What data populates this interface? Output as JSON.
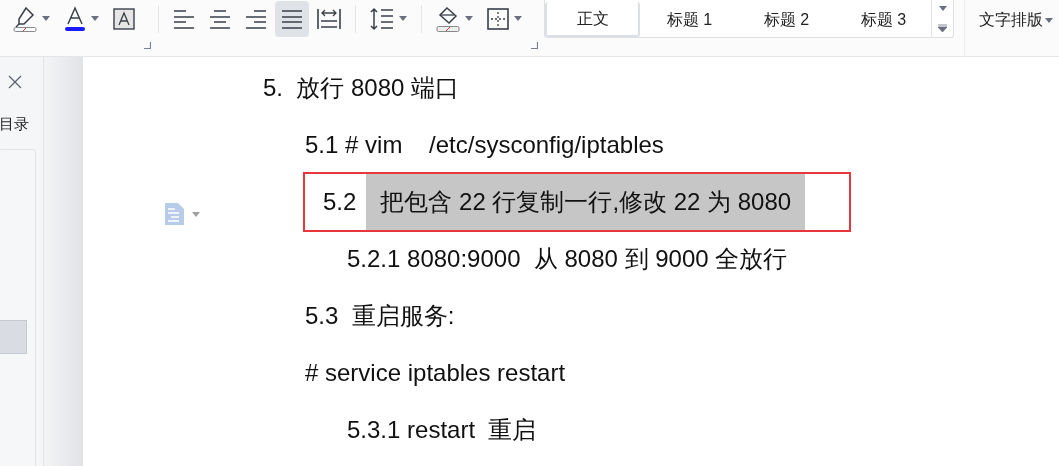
{
  "toolbar": {
    "tools": [
      {
        "kind": "highlighter",
        "selected": false
      },
      {
        "kind": "font-color",
        "selected": false
      },
      {
        "kind": "char-shading",
        "selected": false
      },
      {
        "kind": "launcher"
      },
      {
        "kind": "divider"
      },
      {
        "kind": "align-left",
        "selected": false
      },
      {
        "kind": "align-center",
        "selected": false
      },
      {
        "kind": "align-right",
        "selected": false
      },
      {
        "kind": "justify",
        "selected": true
      },
      {
        "kind": "distribute",
        "selected": false
      },
      {
        "kind": "divider"
      },
      {
        "kind": "line-spacing",
        "selected": false
      },
      {
        "kind": "divider"
      },
      {
        "kind": "shading",
        "selected": false
      },
      {
        "kind": "borders",
        "selected": false
      },
      {
        "kind": "launcher"
      }
    ],
    "styles": [
      {
        "label": "正文",
        "selected": true
      },
      {
        "label": "标题 1",
        "selected": false
      },
      {
        "label": "标题 2",
        "selected": false
      },
      {
        "label": "标题 3",
        "selected": false
      }
    ],
    "layout_button": "文字排版"
  },
  "side_panel": {
    "title": "目录"
  },
  "document": {
    "paragraphs": [
      {
        "text": "5.  放行 8080 端口",
        "selected": false,
        "children": [
          {
            "text": "5.1 # vim    /etc/sysconfig/iptables",
            "selected": false
          },
          {
            "number": "5.2",
            "text": "把包含 22 行复制一行,修改 22 为 8080",
            "selected": true,
            "marked": true,
            "children": [
              {
                "text": "5.2.1 8080:9000  从 8080 到 9000 全放行",
                "selected": false
              }
            ]
          },
          {
            "text": "5.3  重启服务:",
            "selected": false
          },
          {
            "text": "# service iptables restart",
            "selected": false,
            "children": [
              {
                "text": "5.3.1 restart  重启",
                "selected": false
              }
            ]
          }
        ]
      }
    ]
  }
}
